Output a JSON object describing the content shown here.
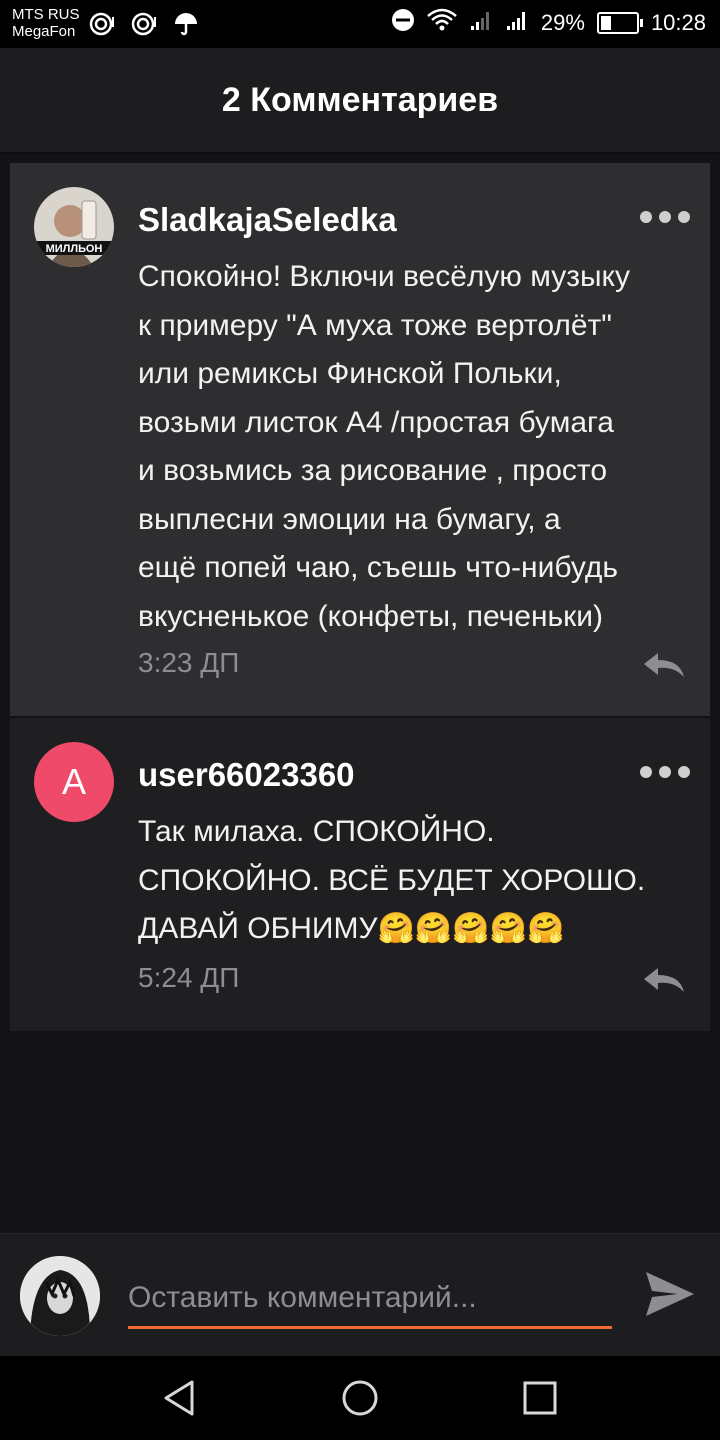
{
  "status_bar": {
    "carrier_1": "MTS RUS",
    "carrier_2": "MegaFon",
    "battery_percent": "29%",
    "battery_level": 0.29,
    "time": "10:28"
  },
  "header": {
    "title": "2 Комментариев"
  },
  "comments": [
    {
      "username": "SladkajaSeledka",
      "avatar_caption": "МИЛЛЬОН",
      "text": "Спокойно! Включи весёлую музыку\nк примеру \"А муха тоже вертолёт\"\nили ремиксы Финской Польки,\nвозьми листок А4 /простая бумага\nи возьмись за рисование , просто\nвыплесни эмоции на бумагу, а\nещё попей чаю, съешь что-нибудь\nвкусненькое (конфеты, печеньки)",
      "time": "3:23 ДП"
    },
    {
      "username": "user66023360",
      "avatar_letter": "A",
      "text": "Так милаха. СПОКОЙНО.\nСПОКОЙНО. ВСЁ БУДЕТ ХОРОШО.\nДАВАЙ ОБНИМУ🤗🤗🤗🤗🤗",
      "time": "5:24 ДП"
    }
  ],
  "composer": {
    "placeholder": "Оставить комментарий..."
  },
  "colors": {
    "accent": "#ee6a2e",
    "avatar_a": "#ef4a6a"
  }
}
